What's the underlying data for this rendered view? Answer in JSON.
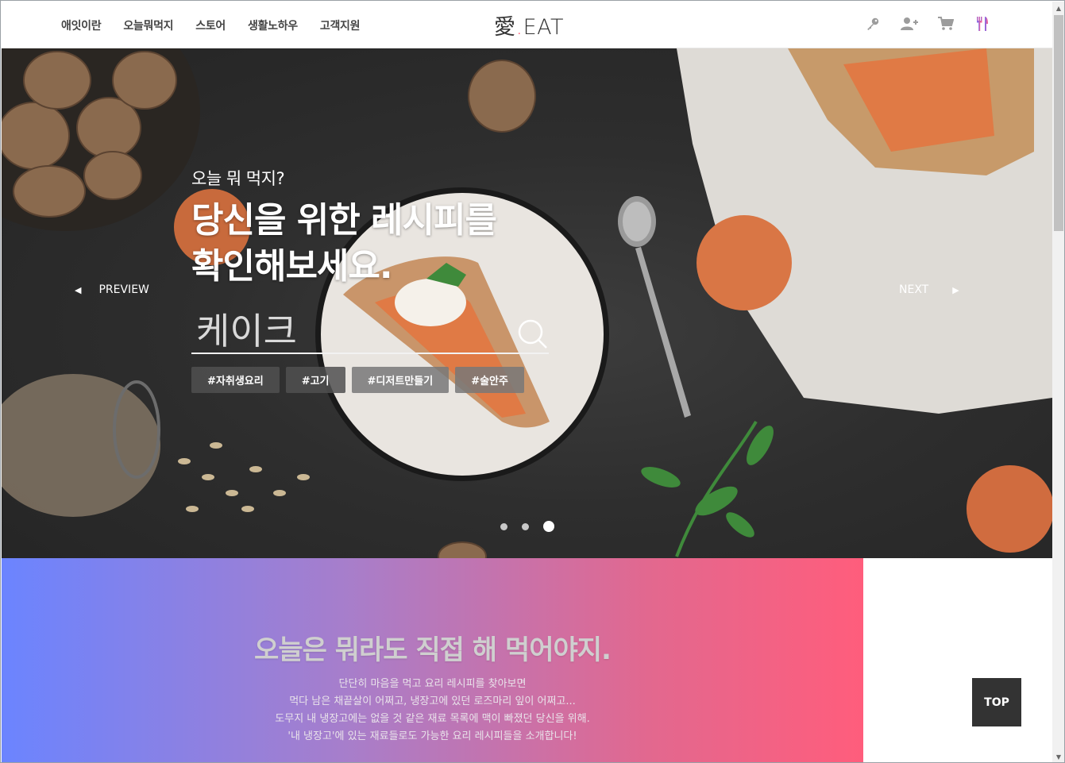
{
  "nav": {
    "items": [
      "애잇이란",
      "오늘뭐먹지",
      "스토어",
      "생활노하우",
      "고객지원"
    ]
  },
  "logo": {
    "char": "愛",
    "dot": ".",
    "text": "EAT"
  },
  "header_icons": [
    "key-icon",
    "add-user-icon",
    "cart-icon",
    "utensils-icon"
  ],
  "hero": {
    "subtitle": "오늘 뭐 먹지?",
    "title_line1": "당신을 위한 레시피를",
    "title_line2": "확인해보세요.",
    "search_placeholder": "케이크",
    "tags": [
      "#자취생요리",
      "#고기",
      "#디저트만들기",
      "#술안주"
    ],
    "prev_label": "PREVIEW",
    "next_label": "NEXT",
    "slide_count": 3,
    "active_slide": 3
  },
  "intro": {
    "title": "오늘은 뭐라도 직접 해 먹어야지.",
    "lines": [
      "단단히 마음을 먹고 요리 레시피를 찾아보면",
      "먹다 남은 채끝살이 어쩌고, 냉장고에 있던 로즈마리 잎이 어쩌고...",
      "도무지 내 냉장고에는 없을 것 같은 재료 목록에 맥이 빠졌던 당신을 위해.",
      "'내 냉장고'에 있는 재료들로도 가능한 요리 레시피들을 소개합니다!"
    ]
  },
  "top_button": "TOP",
  "colors": {
    "accent": "#ff4f6a",
    "gradient_start": "#6b84ff",
    "gradient_end": "#ff5d7c",
    "utensils": "#b061d9"
  }
}
